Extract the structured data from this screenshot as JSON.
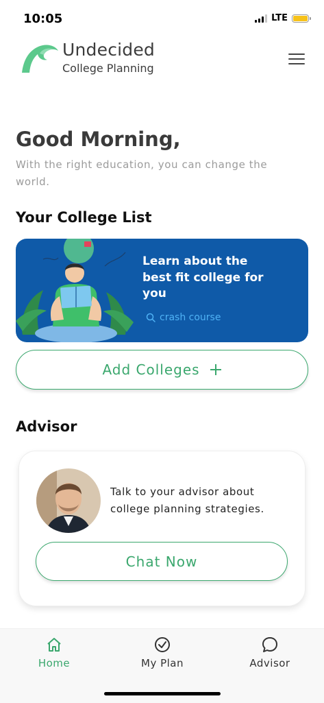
{
  "status_bar": {
    "time": "10:05",
    "network": "LTE",
    "battery_color": "#f7c21a"
  },
  "header": {
    "brand_title": "Undecided",
    "brand_subtitle": "College Planning",
    "logo_icon": "wave-logo-icon",
    "menu_icon": "hamburger-menu-icon"
  },
  "greeting": {
    "title": "Good Morning,",
    "subtitle": "With the right education, you can change the world."
  },
  "college_list": {
    "section_title": "Your College List",
    "promo": {
      "text": "Learn about the best fit college for you",
      "link_label": "crash course",
      "link_icon": "search-icon"
    },
    "add_button_label": "Add Colleges",
    "add_icon": "plus-icon"
  },
  "advisor": {
    "section_title": "Advisor",
    "message": "Talk to your advisor about college planning strategies.",
    "chat_button_label": "Chat Now"
  },
  "tab_bar": {
    "tabs": [
      {
        "label": "Home",
        "icon": "home-icon",
        "active": true
      },
      {
        "label": "My Plan",
        "icon": "check-circle-icon",
        "active": false
      },
      {
        "label": "Advisor",
        "icon": "chat-bubble-icon",
        "active": false
      }
    ]
  },
  "colors": {
    "accent": "#3aa76d",
    "promo_background": "#0f5aa8",
    "promo_link": "#4fb2f5"
  }
}
